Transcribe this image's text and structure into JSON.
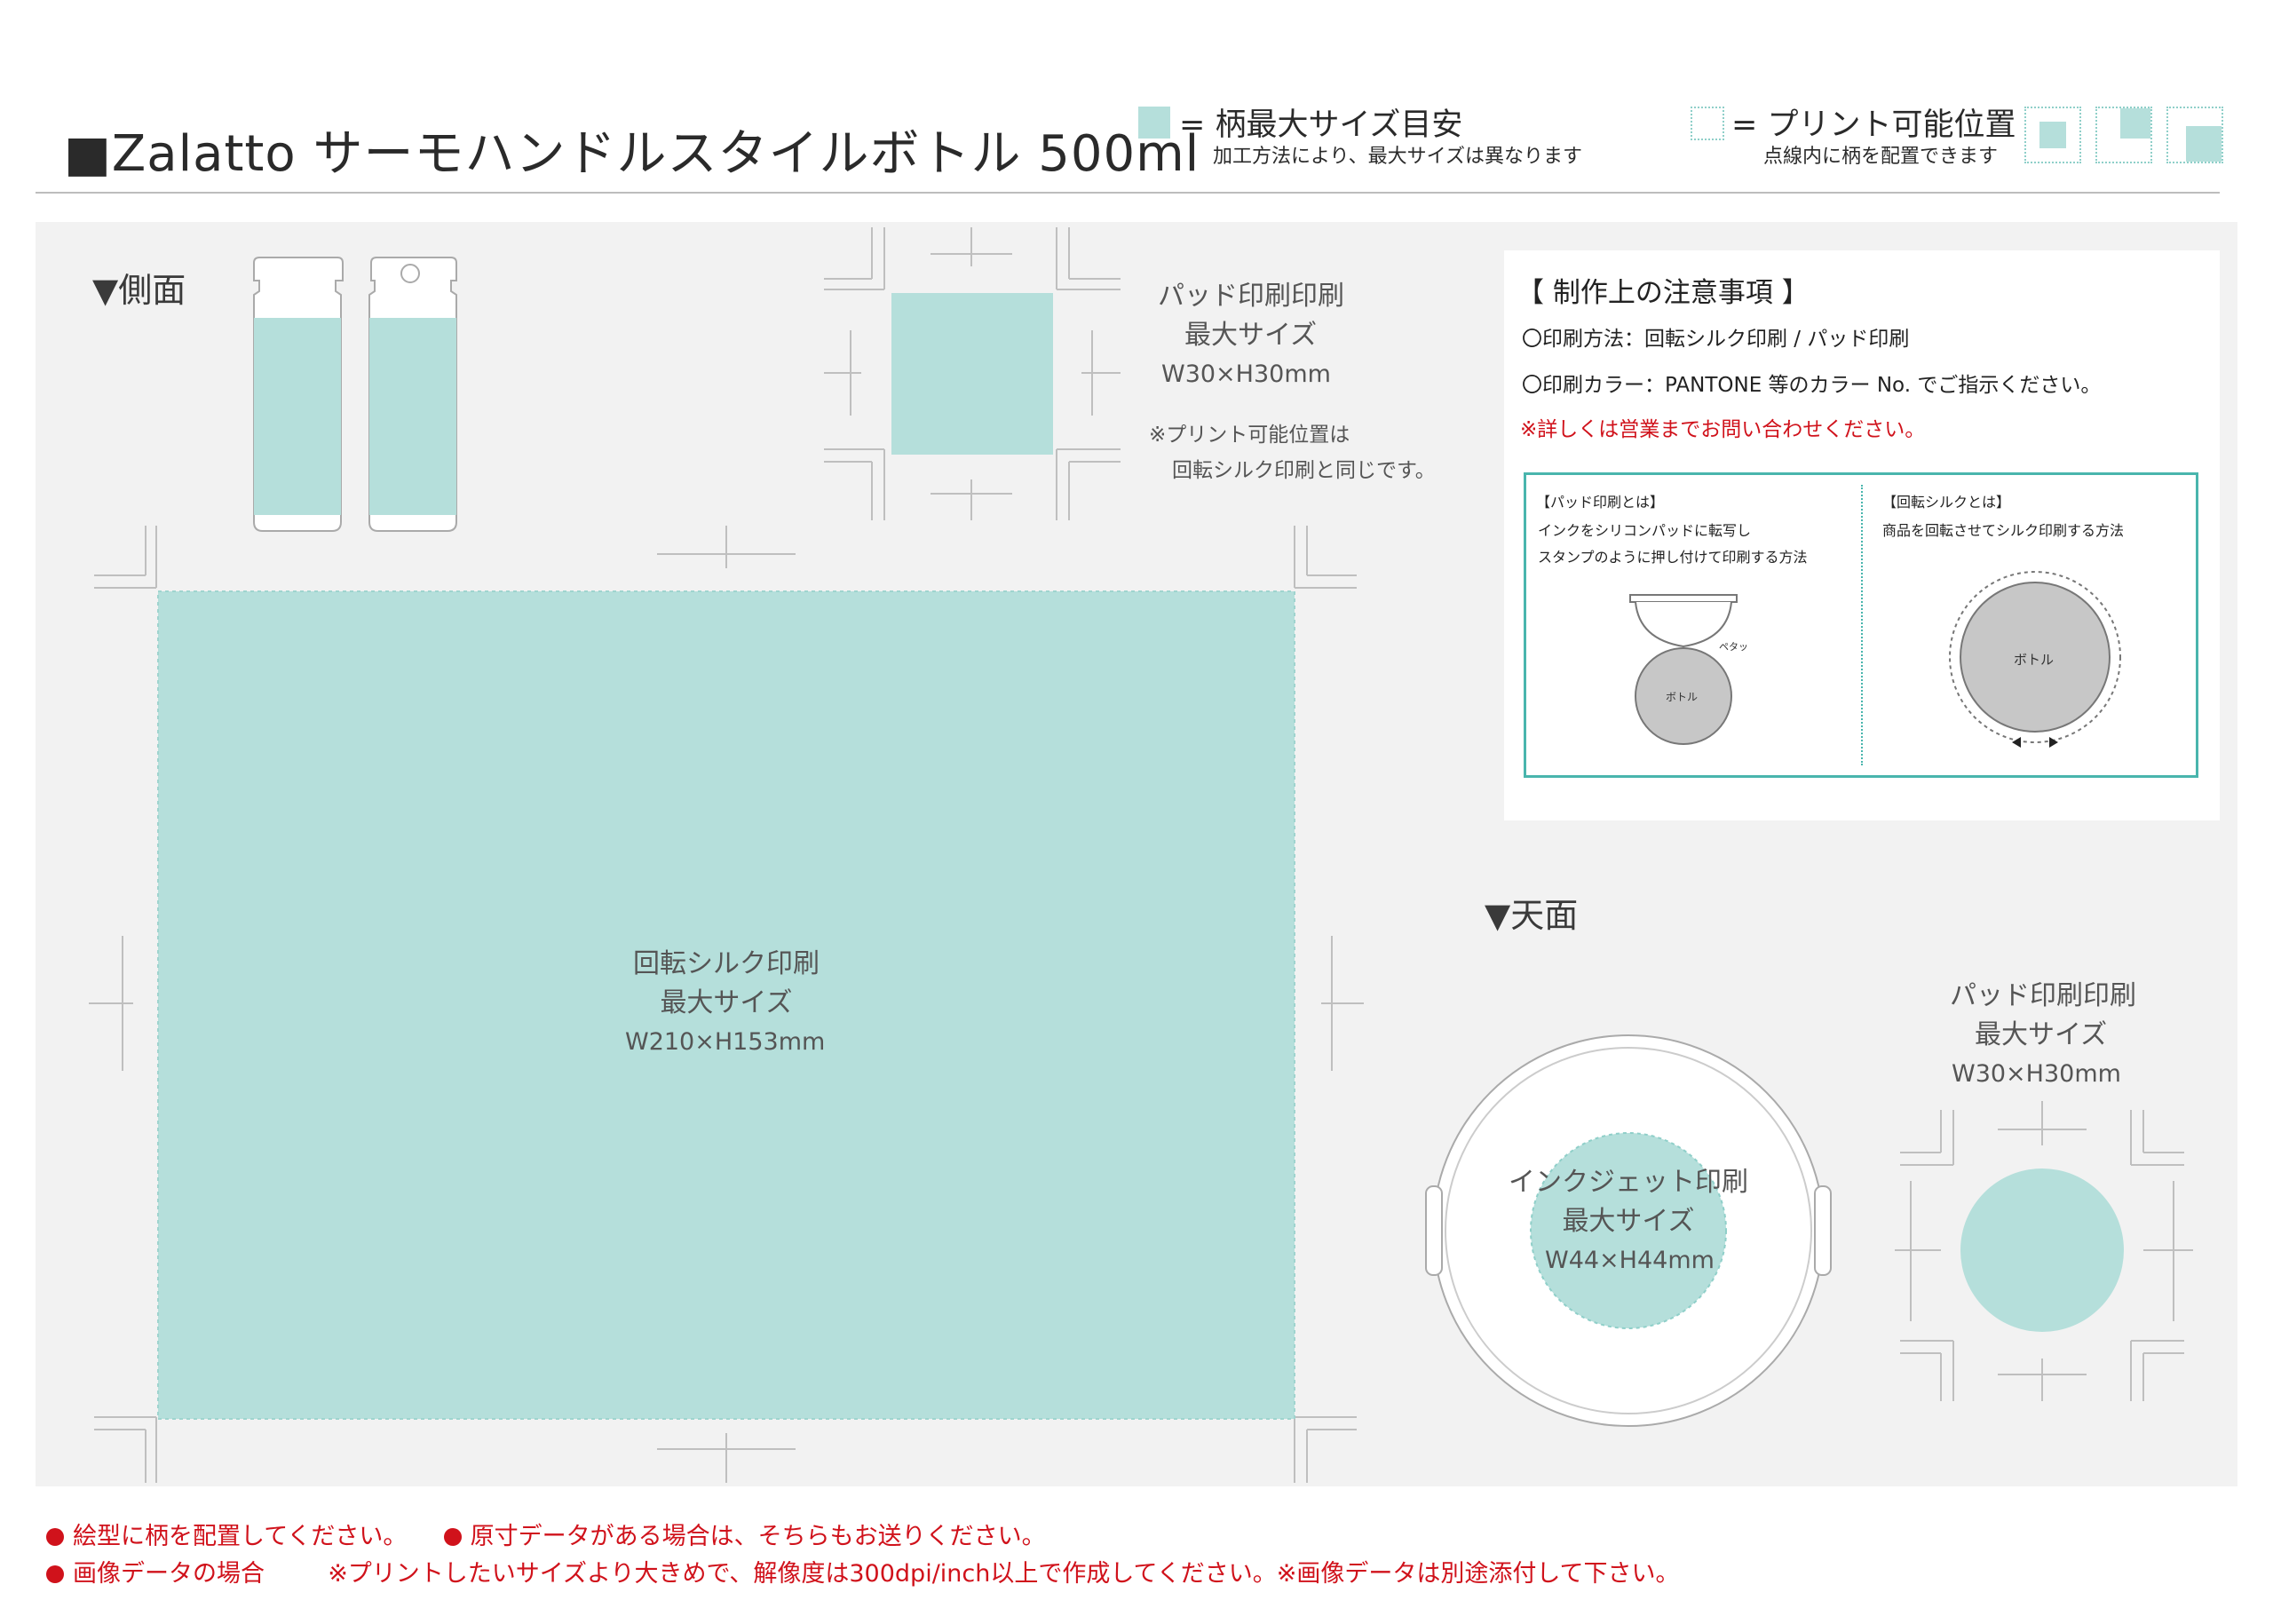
{
  "header": {
    "title": "■Zalatto サーモハンドルスタイルボトル 500ml",
    "legend_max_size": "= 柄最大サイズ目安",
    "legend_max_size_note": "加工方法により、最大サイズは異なります",
    "legend_printable": "= プリント可能位置",
    "legend_printable_note": "点線内に柄を配置できます"
  },
  "side": {
    "section_title": "▼側面",
    "silk_label_1": "回転シルク印刷",
    "silk_label_2": "最大サイズ",
    "silk_size": "W210×H153mm",
    "pad_label_1": "パッド印刷印刷",
    "pad_label_2": "最大サイズ",
    "pad_size": "W30×H30mm",
    "pad_note_1": "※プリント可能位置は",
    "pad_note_2": "回転シルク印刷と同じです。"
  },
  "top": {
    "section_title": "▼天面",
    "inkjet_label_1": "インクジェット印刷",
    "inkjet_label_2": "最大サイズ",
    "inkjet_size": "W44×H44mm",
    "pad_label_1": "パッド印刷印刷",
    "pad_label_2": "最大サイズ",
    "pad_size": "W30×H30mm"
  },
  "notice": {
    "heading": "【 制作上の注意事項 】",
    "method": "〇印刷方法：回転シルク印刷 / パッド印刷",
    "color": "〇印刷カラー：PANTONE 等のカラー No. でご指示ください。",
    "warning": "※詳しくは営業までお問い合わせください。",
    "pad_title": "【パッド印刷とは】",
    "pad_desc_1": "インクをシリコンパッドに転写し",
    "pad_desc_2": "スタンプのように押し付けて印刷する方法",
    "pad_tag": "ペタッ",
    "pad_bottle": "ボトル",
    "silk_title": "【回転シルクとは】",
    "silk_desc": "商品を回転させてシルク印刷する方法",
    "silk_bottle": "ボトル"
  },
  "footer": {
    "line1a": "絵型に柄を配置してください。",
    "line1b": "原寸データがある場合は、そちらもお送りください。",
    "line2a": "画像データの場合",
    "line2b": "※プリントしたいサイズより大きめで、解像度は300dpi/inch以上で作成してください。※画像データは別途添付して下さい。"
  },
  "colors": {
    "print_area": "#b5dfdb",
    "panel": "#f2f2f2",
    "accent": "#49b5ad",
    "warning": "#d0121b"
  }
}
